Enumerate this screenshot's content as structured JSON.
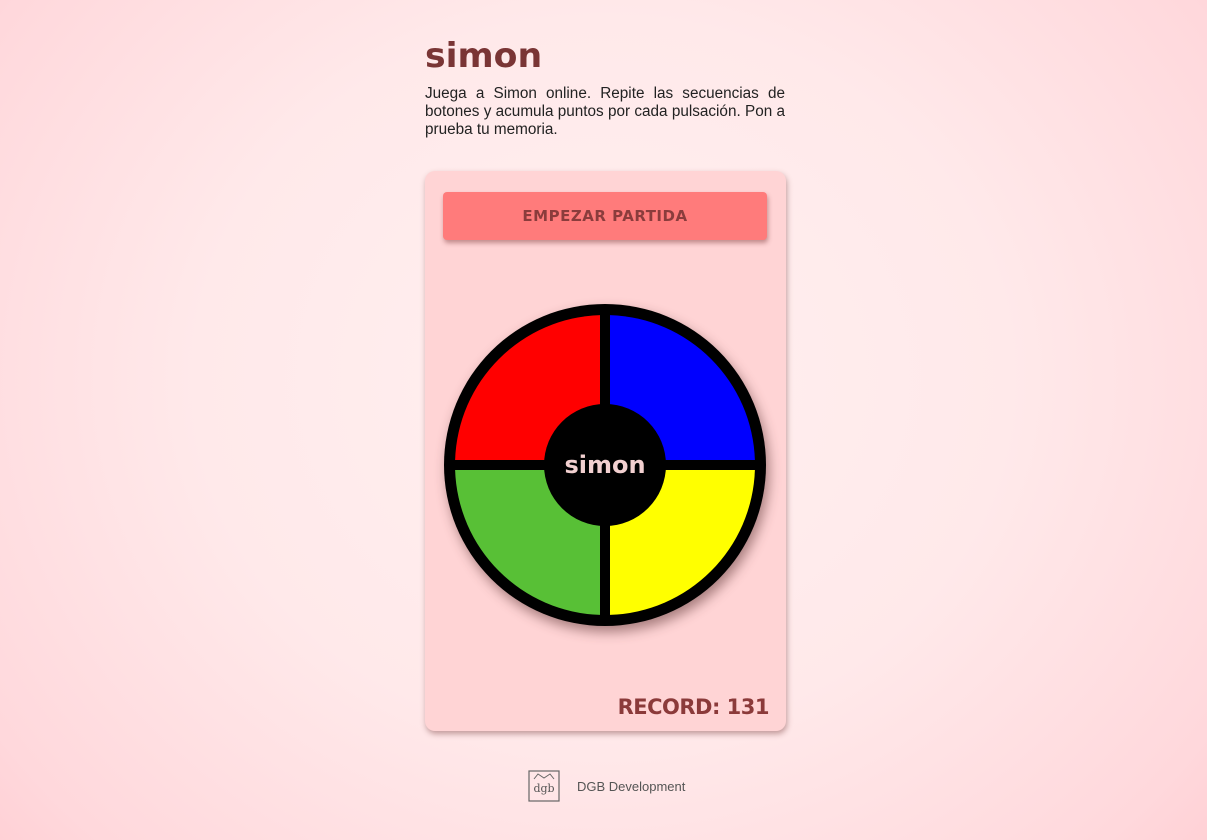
{
  "page": {
    "title": "simon",
    "description": "Juega a Simon online. Repite las secuencias de botones y acumula puntos por cada pulsación. Pon a prueba tu memoria."
  },
  "game": {
    "start_button_label": "EMPEZAR PARTIDA",
    "center_label": "simon",
    "record_label": "RECORD: 131",
    "pads": [
      {
        "name": "red",
        "color": "#ff0000"
      },
      {
        "name": "blue",
        "color": "#0000ff"
      },
      {
        "name": "green",
        "color": "#58c036"
      },
      {
        "name": "yellow",
        "color": "#ffff00"
      }
    ]
  },
  "footer": {
    "logo_text": "dgb",
    "text": "DGB Development"
  },
  "colors": {
    "title": "#7a3535",
    "card_background": "#ffd4d5",
    "start_button": "#ff7b7b",
    "record": "#8b3a3a"
  }
}
